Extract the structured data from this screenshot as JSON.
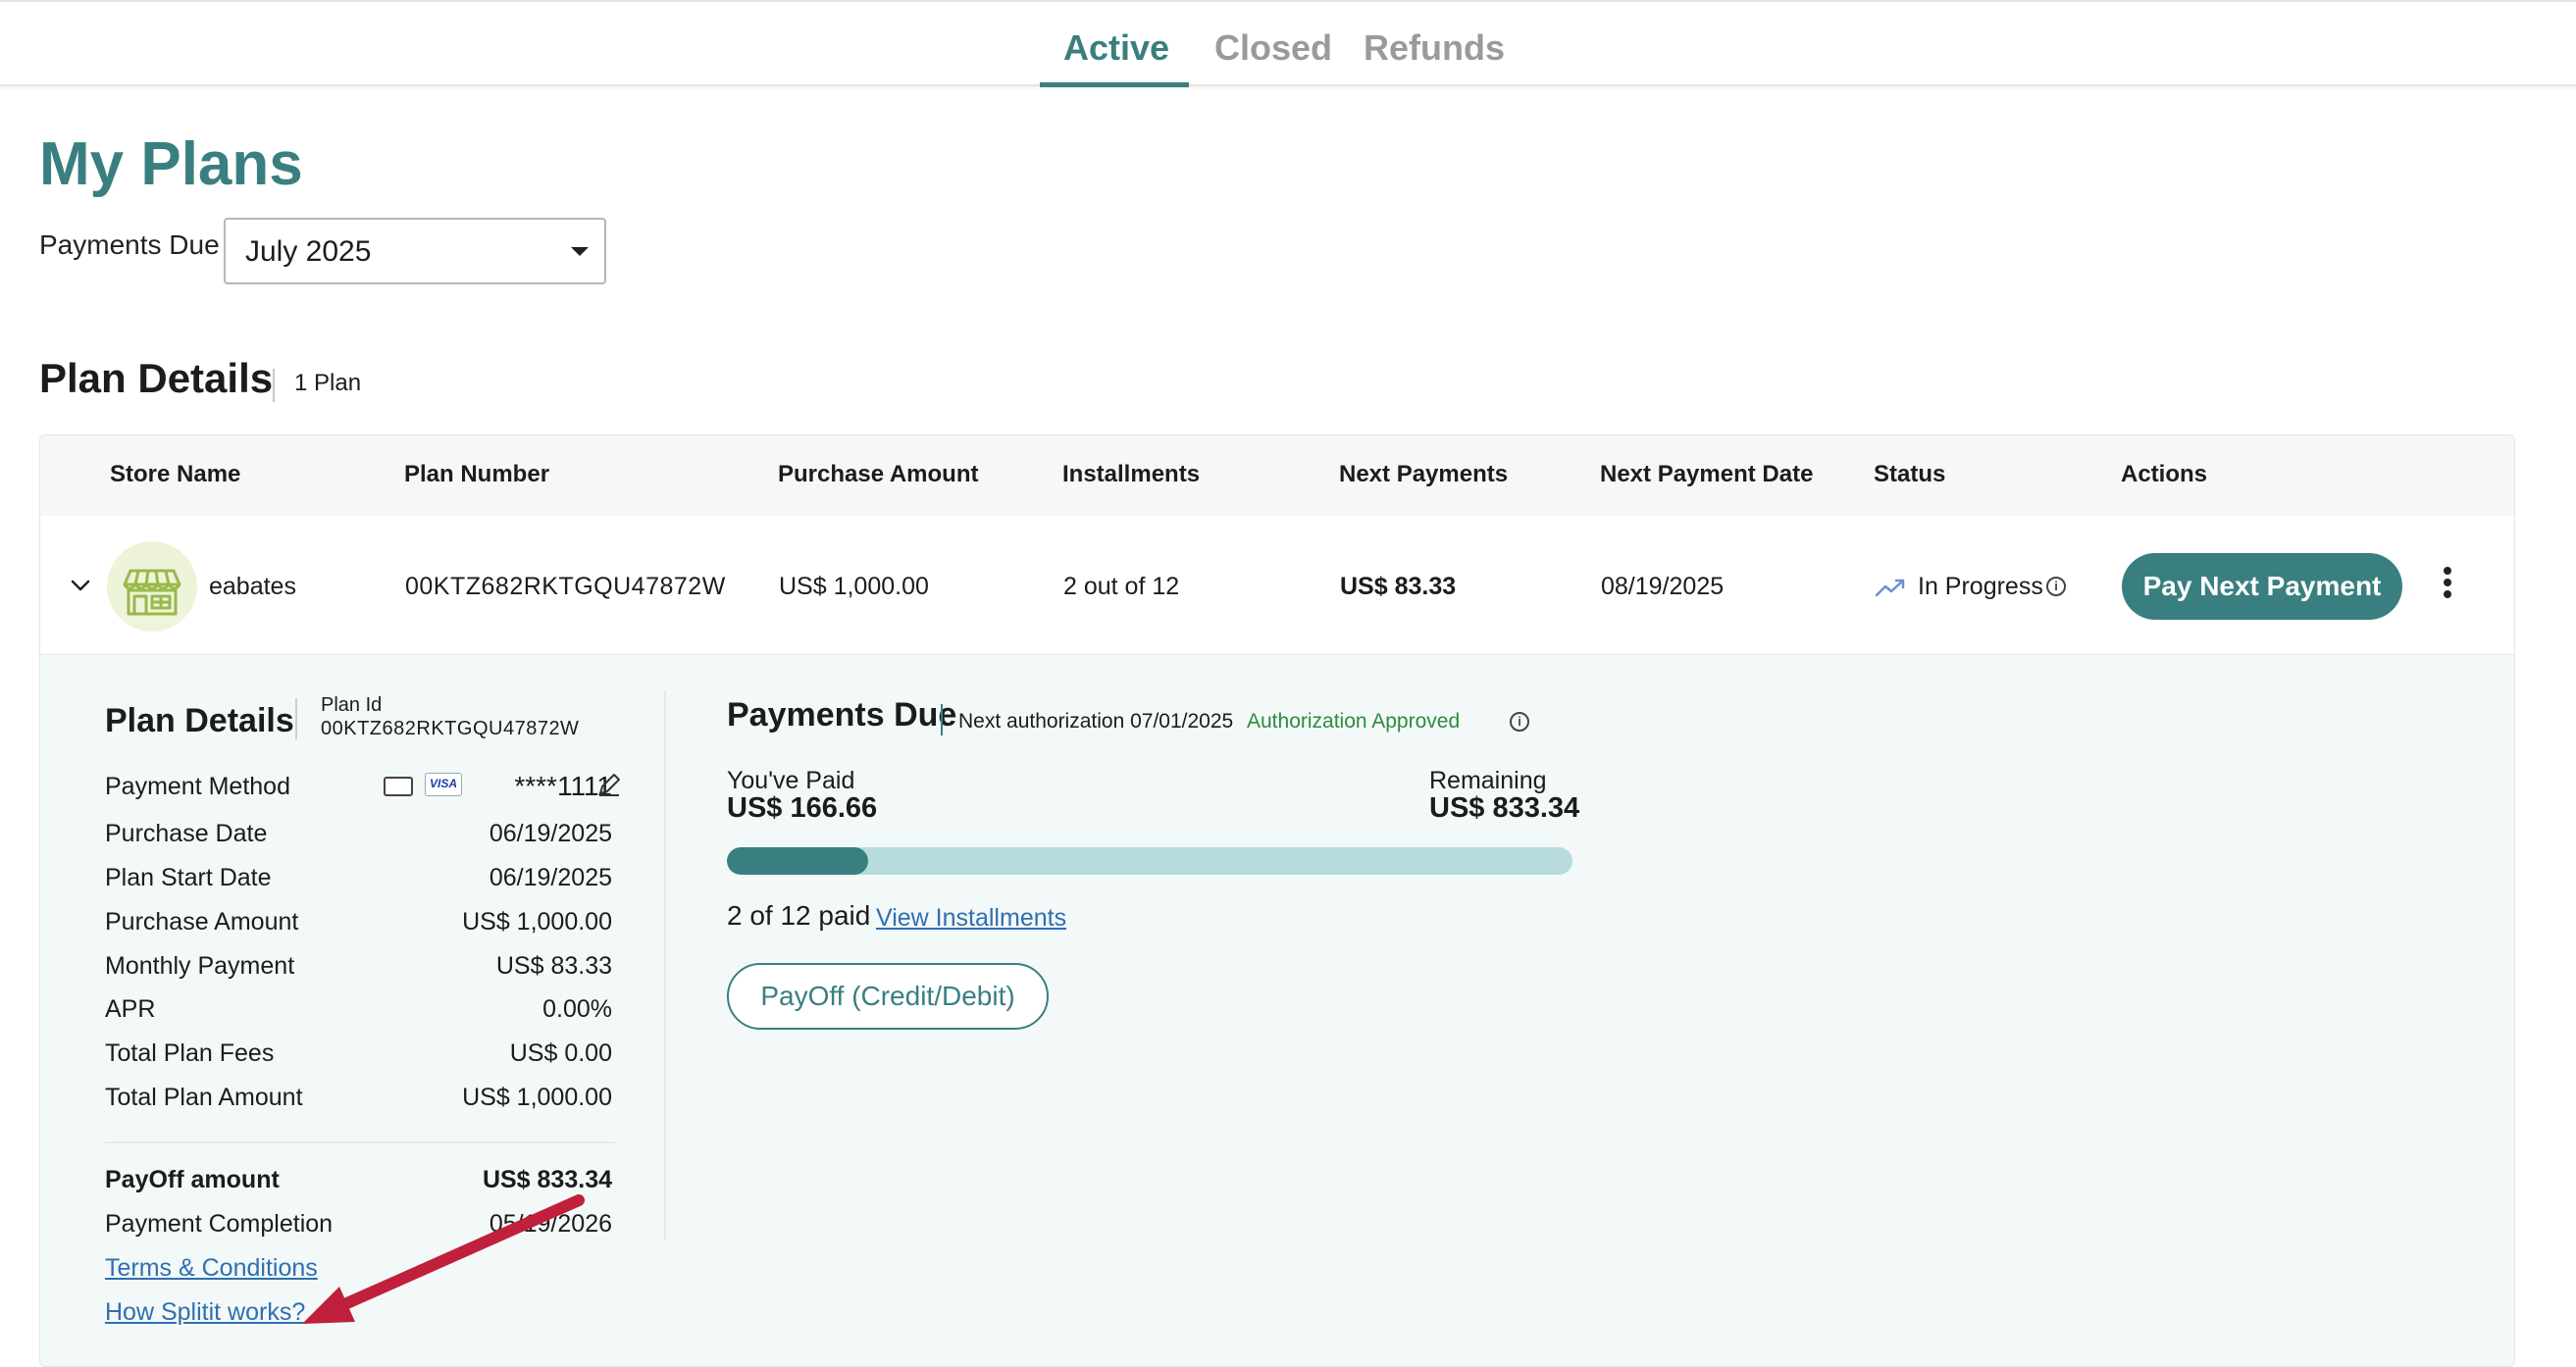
{
  "tabs": [
    {
      "label": "Active",
      "active": true
    },
    {
      "label": "Closed",
      "active": false
    },
    {
      "label": "Refunds",
      "active": false
    }
  ],
  "page_title": "My Plans",
  "payments_due": {
    "label": "Payments Due",
    "selected": "July 2025"
  },
  "plan_section": {
    "title": "Plan Details",
    "count": "1 Plan"
  },
  "table": {
    "headers": [
      "Store Name",
      "Plan Number",
      "Purchase Amount",
      "Installments",
      "Next Payments",
      "Next Payment Date",
      "Status",
      "Actions"
    ],
    "row": {
      "store": "eabates",
      "plan_number": "00KTZ682RKTGQU47872W",
      "purchase_amount": "US$ 1,000.00",
      "installments": "2 out of 12",
      "next_payment": "US$ 83.33",
      "next_payment_date": "08/19/2025",
      "status": "In Progress",
      "action_button": "Pay Next Payment"
    }
  },
  "details": {
    "title": "Plan Details",
    "plan_id_label": "Plan Id",
    "plan_id": "00KTZ682RKTGQU47872W",
    "payment_method_label": "Payment Method",
    "card_brand": "VISA",
    "card_mask": "****1111",
    "rows": [
      {
        "label": "Purchase Date",
        "value": "06/19/2025"
      },
      {
        "label": "Plan Start Date",
        "value": "06/19/2025"
      },
      {
        "label": "Purchase Amount",
        "value": "US$ 1,000.00"
      },
      {
        "label": "Monthly Payment",
        "value": "US$ 83.33"
      },
      {
        "label": "APR",
        "value": "0.00%"
      },
      {
        "label": "Total Plan Fees",
        "value": "US$ 0.00"
      },
      {
        "label": "Total Plan Amount",
        "value": "US$ 1,000.00"
      }
    ],
    "payoff_label": "PayOff amount",
    "payoff_value": "US$ 833.34",
    "completion_label": "Payment Completion",
    "completion_value": "05/19/2026",
    "terms_link": "Terms & Conditions",
    "how_link": "How Splitit works?"
  },
  "payments": {
    "title": "Payments Due",
    "next_auth": "Next authorization 07/01/2025",
    "auth_status": "Authorization Approved",
    "paid_label": "You've Paid",
    "paid_value": "US$ 166.66",
    "remaining_label": "Remaining",
    "remaining_value": "US$ 833.34",
    "progress_fraction": 0.1667,
    "count_text": "2 of 12 paid",
    "view_link": "View Installments",
    "payoff_button": "PayOff (Credit/Debit)"
  },
  "colors": {
    "brand": "#3a7f80",
    "link": "#2f6fb0",
    "approved": "#2e8b3e",
    "annotation_arrow": "#c0203b"
  }
}
